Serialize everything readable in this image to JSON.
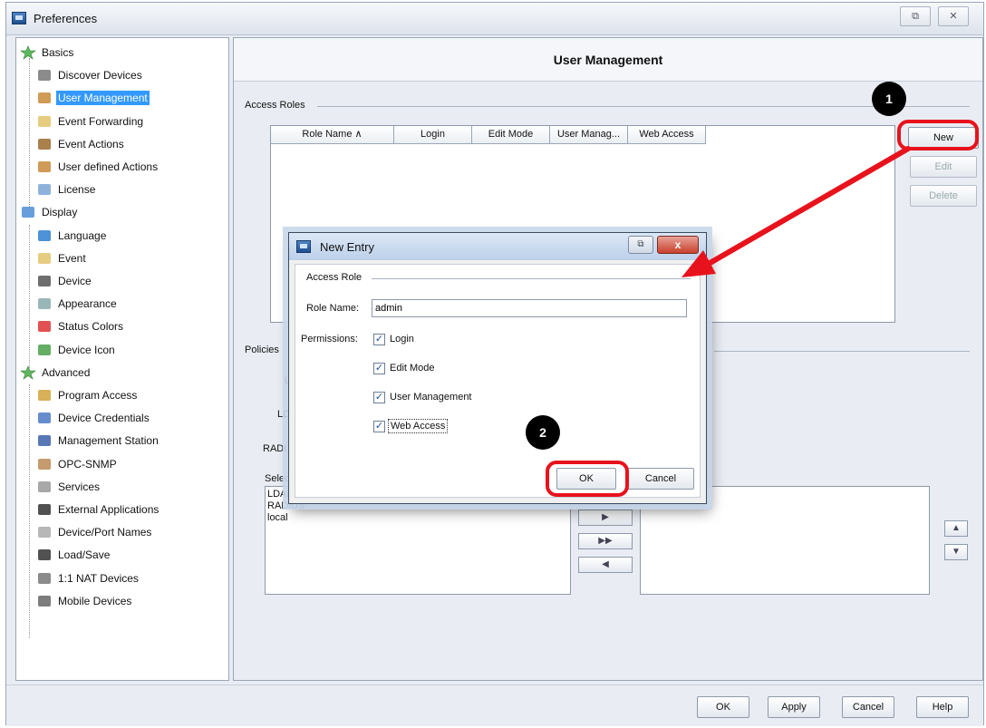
{
  "window": {
    "title": "Preferences"
  },
  "nav": {
    "items": [
      {
        "label": "Basics",
        "icon": "star-icon",
        "level": 0
      },
      {
        "label": "Discover Devices",
        "icon": "magnifier-icon",
        "level": 1
      },
      {
        "label": "User Management",
        "icon": "users-icon",
        "level": 1,
        "selected": true
      },
      {
        "label": "Event Forwarding",
        "icon": "folder-icon",
        "level": 1
      },
      {
        "label": "Event Actions",
        "icon": "hammer-icon",
        "level": 1
      },
      {
        "label": "User defined Actions",
        "icon": "users-icon",
        "level": 1
      },
      {
        "label": "License",
        "icon": "license-icon",
        "level": 1
      },
      {
        "label": "Display",
        "icon": "display-icon",
        "level": 0
      },
      {
        "label": "Language",
        "icon": "globe-icon",
        "level": 1
      },
      {
        "label": "Event",
        "icon": "folder-icon",
        "level": 1
      },
      {
        "label": "Device",
        "icon": "device-icon",
        "level": 1
      },
      {
        "label": "Appearance",
        "icon": "window-icon",
        "level": 1
      },
      {
        "label": "Status Colors",
        "icon": "color-wheel-icon",
        "level": 1
      },
      {
        "label": "Device Icon",
        "icon": "image-icon",
        "level": 1
      },
      {
        "label": "Advanced",
        "icon": "star-icon",
        "level": 0
      },
      {
        "label": "Program Access",
        "icon": "key-icon",
        "level": 1
      },
      {
        "label": "Device Credentials",
        "icon": "credentials-icon",
        "level": 1
      },
      {
        "label": "Management Station",
        "icon": "station-icon",
        "level": 1
      },
      {
        "label": "OPC-SNMP",
        "icon": "opc-icon",
        "level": 1
      },
      {
        "label": "Services",
        "icon": "gear-icon",
        "level": 1
      },
      {
        "label": "External Applications",
        "icon": "app-icon",
        "level": 1
      },
      {
        "label": "Device/Port Names",
        "icon": "port-icon",
        "level": 1
      },
      {
        "label": "Load/Save",
        "icon": "floppy-icon",
        "level": 1
      },
      {
        "label": "1:1 NAT Devices",
        "icon": "nat-icon",
        "level": 1
      },
      {
        "label": "Mobile Devices",
        "icon": "mobile-icon",
        "level": 1
      }
    ]
  },
  "main": {
    "title": "User Management",
    "access_roles_label": "Access Roles",
    "columns": [
      "Role Name ∧",
      "Login",
      "Edit Mode",
      "User Manag...",
      "Web Access"
    ],
    "buttons": {
      "new": "New",
      "edit": "Edit",
      "delete": "Delete"
    },
    "policies": {
      "label": "Policies",
      "field1": "Lo",
      "field2": "LDA",
      "field3": "RADI",
      "select_label": "Select",
      "available": [
        "LDAP",
        "RADIUS",
        "local"
      ],
      "move_right": "▶",
      "move_all_right": "▶▶",
      "move_left": "◀",
      "up": "▲",
      "down": "▼"
    }
  },
  "footer": {
    "ok": "OK",
    "apply": "Apply",
    "cancel": "Cancel",
    "help": "Help"
  },
  "dialog": {
    "title": "New Entry",
    "group_label": "Access Role",
    "role_name_label": "Role Name:",
    "role_name_value": "admin",
    "permissions_label": "Permissions:",
    "permissions": [
      {
        "label": "Login",
        "checked": true
      },
      {
        "label": "Edit Mode",
        "checked": true
      },
      {
        "label": "User Management",
        "checked": true
      },
      {
        "label": "Web Access",
        "checked": true
      }
    ],
    "ok": "OK",
    "cancel": "Cancel",
    "close_glyph": "x",
    "restore_glyph": "⧉"
  },
  "annotations": {
    "step1": "1",
    "step2": "2",
    "highlight_color": "#e8121c",
    "badge_color": "#000000"
  }
}
